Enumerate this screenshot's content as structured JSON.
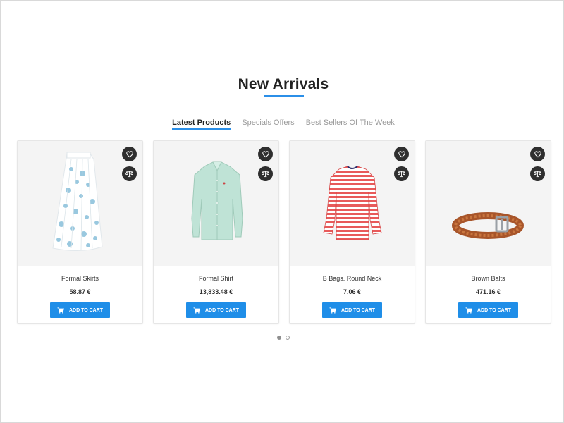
{
  "section": {
    "title": "New Arrivals"
  },
  "tabs": [
    {
      "label": "Latest Products",
      "active": true
    },
    {
      "label": "Specials Offers",
      "active": false
    },
    {
      "label": "Best Sellers Of The Week",
      "active": false
    }
  ],
  "products": [
    {
      "name": "Formal Skirts",
      "price": "58.87 €",
      "cart_label": "ADD TO CART",
      "image": "floral-skirt"
    },
    {
      "name": "Formal Shirt",
      "price": "13,833.48 €",
      "cart_label": "ADD TO CART",
      "image": "mint-shirt"
    },
    {
      "name": "B Bags. Round Neck",
      "price": "7.06 €",
      "cart_label": "ADD TO CART",
      "image": "striped-top"
    },
    {
      "name": "Brown Balts",
      "price": "471.16 €",
      "cart_label": "ADD TO CART",
      "image": "brown-belt"
    }
  ],
  "icons": {
    "wishlist": "heart-icon",
    "compare": "scale-icon",
    "cart": "cart-icon"
  },
  "colors": {
    "accent": "#1f8ee8",
    "action_button": "#2f2f2f",
    "image_background": "#f4f4f4"
  },
  "carousel": {
    "pages": 2,
    "active_page": 1
  }
}
